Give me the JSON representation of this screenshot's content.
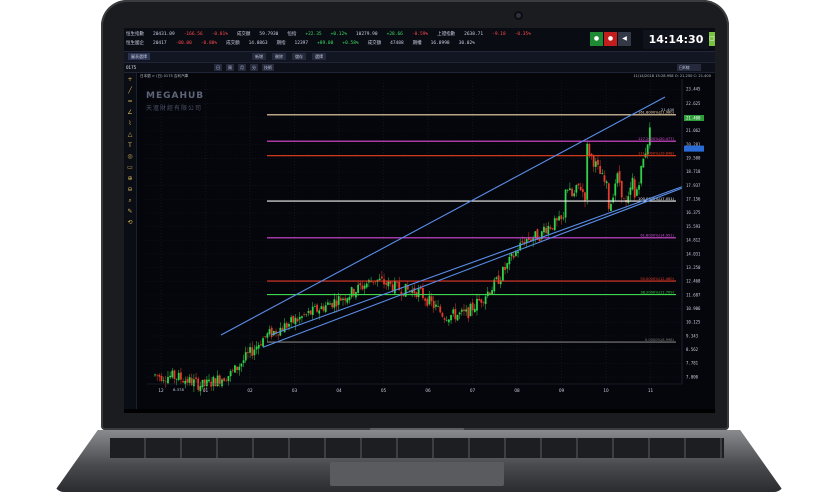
{
  "clock": "14:14:30",
  "ticker": {
    "row1": [
      "恒生指數",
      "20431.09",
      "-166.56",
      "-0.81%",
      "成交額",
      "59.7930",
      "恒指",
      "+22.35",
      "+0.12%",
      "10279.90",
      "+28.66",
      "-0.59%",
      "上證指數",
      "2638.71",
      "-9.18",
      "-0.35%"
    ],
    "row2": [
      "恒生國企",
      "20417",
      "-80.00",
      "-0.80%",
      "成交額",
      "14.8863",
      "期指",
      "12397",
      "+89.00",
      "+0.58%",
      "成交額",
      "47488",
      "期權",
      "16.8998",
      "30.02%"
    ]
  },
  "controls": [
    "●",
    "●",
    "◀",
    "▢"
  ],
  "toolbar": {
    "tab": "圖表選擇",
    "buttons": [
      "新增",
      "刪除",
      "儲存",
      "選擇"
    ],
    "symbol": "0175",
    "buttons2": [
      "日",
      "周",
      "月",
      "分",
      "技術"
    ],
    "dropdown": "日K線"
  },
  "chart_header": {
    "left": "日本蘭 > (日) 0175 吉利汽車",
    "right": "11/14/2018  15:28.958  O: 21.250  C: 21.400"
  },
  "tools": [
    "+",
    "╱",
    "═",
    "∠",
    "⌇",
    "△",
    "T",
    "◎",
    "▭",
    "⊕",
    "⊖",
    "⌕",
    "✎",
    "⟲"
  ],
  "watermark": {
    "brand": "MEGAHUB",
    "sub": "天滙財經有限公司"
  },
  "chart_data": {
    "type": "candlestick",
    "y_ticks": [
      23.445,
      22.625,
      21.843,
      21.062,
      20.281,
      19.5,
      18.718,
      17.937,
      17.156,
      16.375,
      15.593,
      14.812,
      14.031,
      13.25,
      12.468,
      11.687,
      10.906,
      10.125,
      9.343,
      8.562,
      7.781,
      7.0
    ],
    "y_range": [
      6.6,
      23.8
    ],
    "last_price": "21.400",
    "x_labels": [
      "12",
      "01",
      "02",
      "03",
      "04",
      "05",
      "06",
      "07",
      "08",
      "09",
      "10",
      "11"
    ],
    "fib_levels": [
      {
        "label": "161.8000%(21.980)",
        "value": 21.98,
        "color": "#f5d8b0"
      },
      {
        "label": "127.2000%(20.477)",
        "value": 20.477,
        "color": "#e24cd8"
      },
      {
        "label": "111.2000%(19.648)",
        "value": 19.648,
        "color": "#e8401e"
      },
      {
        "label": "100.0000%(17.051)",
        "value": 17.051,
        "color": "#f2f2f2"
      },
      {
        "label": "61.8000%(14.951)",
        "value": 14.951,
        "color": "#d34ad8"
      },
      {
        "label": "50.0000%(12.480)",
        "value": 12.48,
        "color": "#e23a2a"
      },
      {
        "label": "38.2000%(11.709)",
        "value": 11.709,
        "color": "#3ed64c"
      },
      {
        "label": "0.0000%(8.998)",
        "value": 8.998,
        "color": "#7e7e7e"
      }
    ],
    "low_label": "6.378",
    "high_label": "21.400"
  }
}
